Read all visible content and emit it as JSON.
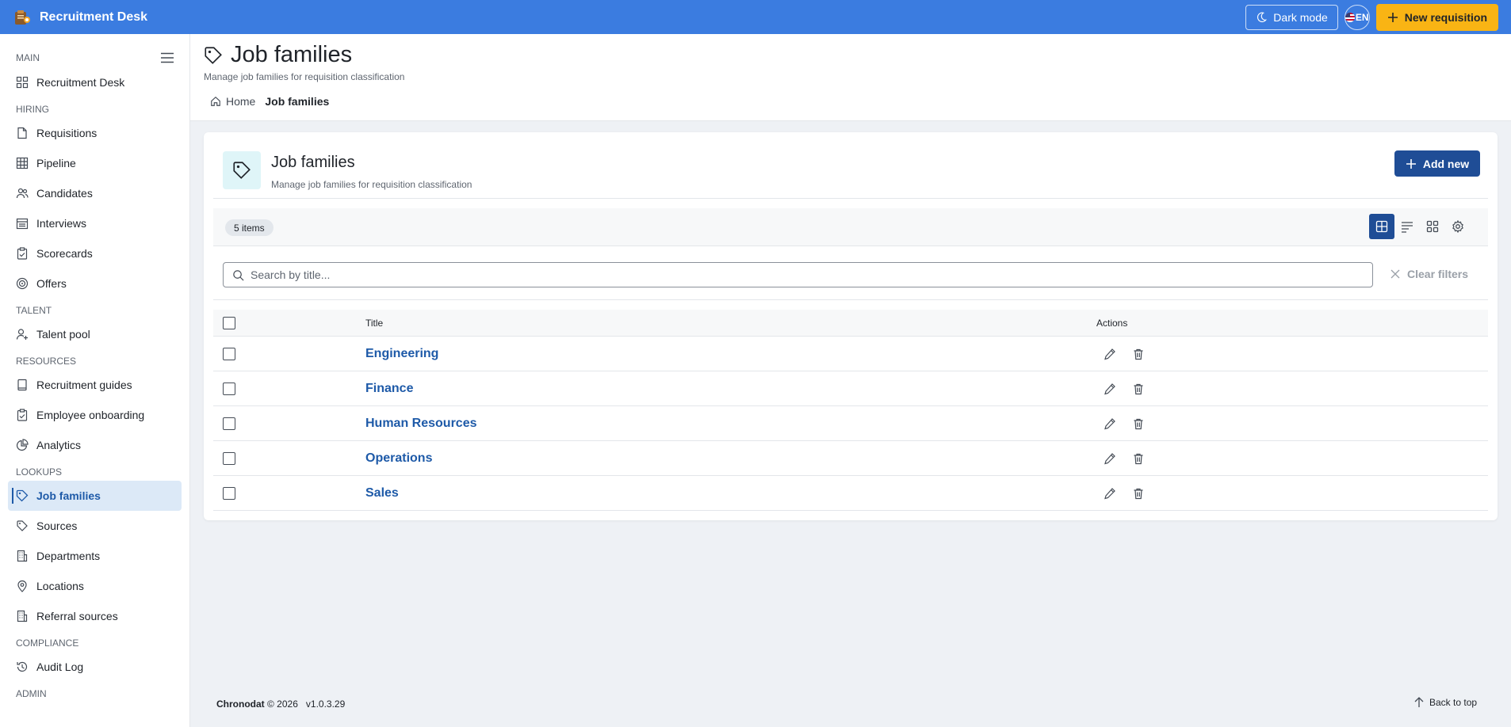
{
  "app": {
    "title": "Recruitment Desk",
    "dark_mode_label": "Dark mode",
    "language": "EN",
    "new_requisition_label": "New requisition"
  },
  "sidebar": {
    "sections": [
      {
        "label": "MAIN",
        "items": [
          {
            "label": "Recruitment Desk",
            "icon": "dashboard-icon"
          }
        ]
      },
      {
        "label": "HIRING",
        "items": [
          {
            "label": "Requisitions",
            "icon": "document-icon"
          },
          {
            "label": "Pipeline",
            "icon": "table-icon"
          },
          {
            "label": "Candidates",
            "icon": "people-icon"
          },
          {
            "label": "Interviews",
            "icon": "calendar-icon"
          },
          {
            "label": "Scorecards",
            "icon": "clipboard-check-icon"
          },
          {
            "label": "Offers",
            "icon": "target-icon"
          }
        ]
      },
      {
        "label": "TALENT",
        "items": [
          {
            "label": "Talent pool",
            "icon": "person-add-icon"
          }
        ]
      },
      {
        "label": "RESOURCES",
        "items": [
          {
            "label": "Recruitment guides",
            "icon": "book-icon"
          },
          {
            "label": "Employee onboarding",
            "icon": "clipboard-check-icon"
          },
          {
            "label": "Analytics",
            "icon": "chart-pie-icon"
          }
        ]
      },
      {
        "label": "LOOKUPS",
        "items": [
          {
            "label": "Job families",
            "icon": "tag-icon",
            "active": true
          },
          {
            "label": "Sources",
            "icon": "tags-icon"
          },
          {
            "label": "Departments",
            "icon": "building-icon"
          },
          {
            "label": "Locations",
            "icon": "location-icon"
          },
          {
            "label": "Referral sources",
            "icon": "building-icon"
          }
        ]
      },
      {
        "label": "COMPLIANCE",
        "items": [
          {
            "label": "Audit Log",
            "icon": "history-icon"
          }
        ]
      },
      {
        "label": "ADMIN",
        "items": []
      }
    ]
  },
  "page": {
    "title": "Job families",
    "subtitle": "Manage job families for requisition classification",
    "breadcrumb": {
      "home": "Home",
      "current": "Job families"
    }
  },
  "card": {
    "title": "Job families",
    "subtitle": "Manage job families for requisition classification",
    "add_label": "Add new",
    "count_label": "5 items",
    "search_placeholder": "Search by title...",
    "clear_label": "Clear filters",
    "columns": {
      "title": "Title",
      "actions": "Actions"
    },
    "rows": [
      {
        "title": "Engineering"
      },
      {
        "title": "Finance"
      },
      {
        "title": "Human Resources"
      },
      {
        "title": "Operations"
      },
      {
        "title": "Sales"
      }
    ]
  },
  "footer": {
    "brand": "Chronodat",
    "copyright": "© 2026",
    "version": "v1.0.3.29",
    "back_to_top": "Back to top"
  },
  "colors": {
    "topbar": "#3b7ce0",
    "accent_button": "#f9b414",
    "primary": "#1f4d96",
    "link": "#1e5aa8"
  }
}
